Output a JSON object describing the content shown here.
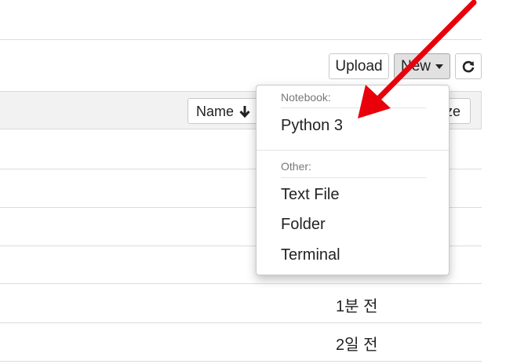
{
  "toolbar": {
    "upload_label": "Upload",
    "new_label": "New",
    "refresh_icon": "refresh-icon"
  },
  "list_header": {
    "sort_name_label": "Name",
    "sort_icon": "arrow-down-icon",
    "size_label_visible": "ze"
  },
  "rows": [
    {
      "modified": ""
    },
    {
      "modified": ""
    },
    {
      "modified": ""
    },
    {
      "modified": ""
    },
    {
      "modified": "1분 전"
    },
    {
      "modified": "2일 전"
    }
  ],
  "new_menu": {
    "notebook_header": "Notebook:",
    "notebook_items": [
      {
        "label": "Python 3"
      }
    ],
    "other_header": "Other:",
    "other_items": [
      {
        "label": "Text File"
      },
      {
        "label": "Folder"
      },
      {
        "label": "Terminal"
      }
    ]
  },
  "annotation": {
    "arrow_color": "#e8000b"
  }
}
